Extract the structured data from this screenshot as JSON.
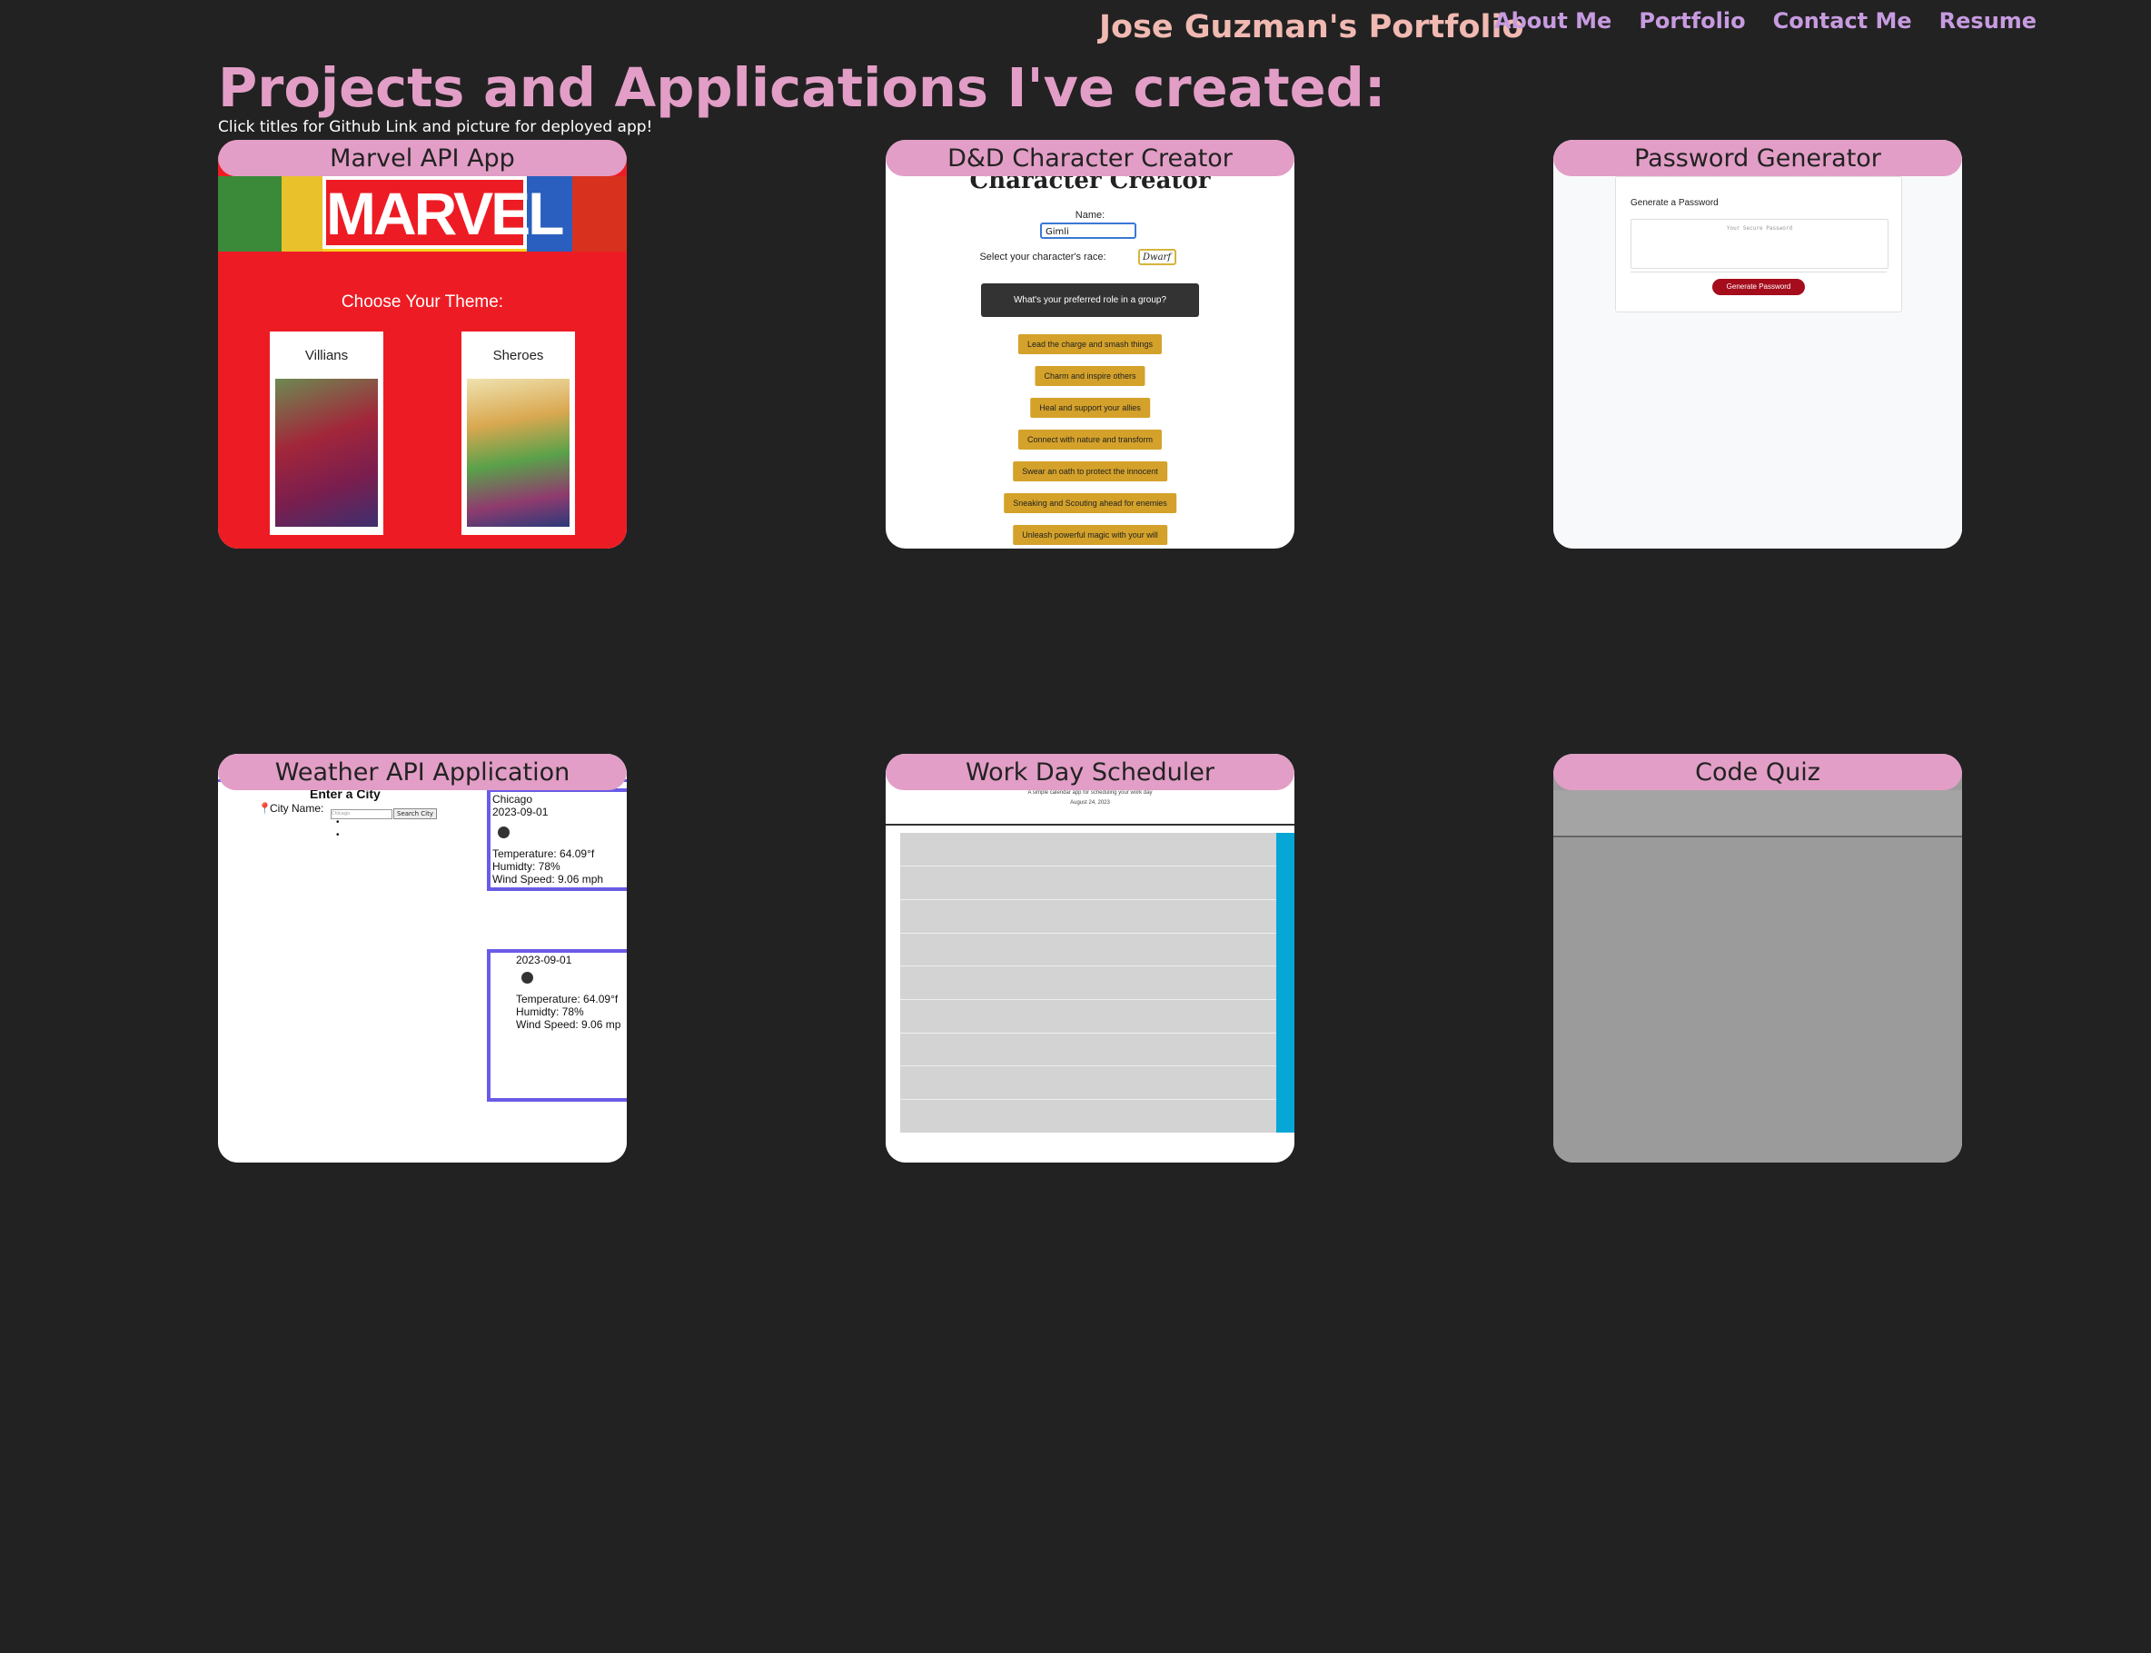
{
  "header": {
    "brand": "Jose Guzman's Portfolio",
    "nav": [
      "About Me",
      "Portfolio",
      "Contact Me",
      "Resume"
    ]
  },
  "page": {
    "title": "Projects and Applications I've created:",
    "subtitle": "Click titles for Github Link and picture for deployed app!"
  },
  "projects": [
    {
      "title": "Marvel API App",
      "screenshot": {
        "logo": "MARVEL",
        "heading": "Choose Your Theme:",
        "themes": [
          "Villians",
          "Sheroes"
        ]
      }
    },
    {
      "title": "D&D Character Creator",
      "screenshot": {
        "heading": "Character Creator",
        "name_label": "Name:",
        "name_value": "Gimli",
        "race_label": "Select your character's race:",
        "race_value": "Dwarf",
        "question": "What's your preferred role in a group?",
        "options": [
          "Lead the charge and smash things",
          "Charm and inspire others",
          "Heal and support your allies",
          "Connect with nature and transform",
          "Swear an oath to protect the innocent",
          "Sneaking and Scouting ahead for enemies",
          "Unleash powerful magic with your will"
        ]
      }
    },
    {
      "title": "Password Generator",
      "screenshot": {
        "heading": "Generate a Password",
        "placeholder": "Your Secure Password",
        "button": "Generate Password"
      }
    },
    {
      "title": "Weather API Application",
      "screenshot": {
        "heading": "Enter a City",
        "city_label": "City Name:",
        "city_placeholder": "Chicago",
        "search_button": "Search City",
        "current": {
          "city": "Chicago",
          "date": "2023-09-01",
          "temperature": "Temperature: 64.09°f",
          "humidity": "Humidty: 78%",
          "wind": "Wind Speed: 9.06 mph"
        },
        "forecast": {
          "date": "2023-09-01",
          "temperature": "Temperature: 64.09°f",
          "humidity": "Humidty: 78%",
          "wind": "Wind Speed: 9.06 mp"
        }
      }
    },
    {
      "title": "Work Day Scheduler",
      "screenshot": {
        "tagline": "A simple calendar app for scheduling your work day",
        "date": "August 24, 2023"
      }
    },
    {
      "title": "Code Quiz",
      "screenshot": {}
    }
  ],
  "colors": {
    "background": "#222222",
    "brand": "#f0b9b2",
    "nav": "#c79be0",
    "accent": "#e29ec6"
  }
}
